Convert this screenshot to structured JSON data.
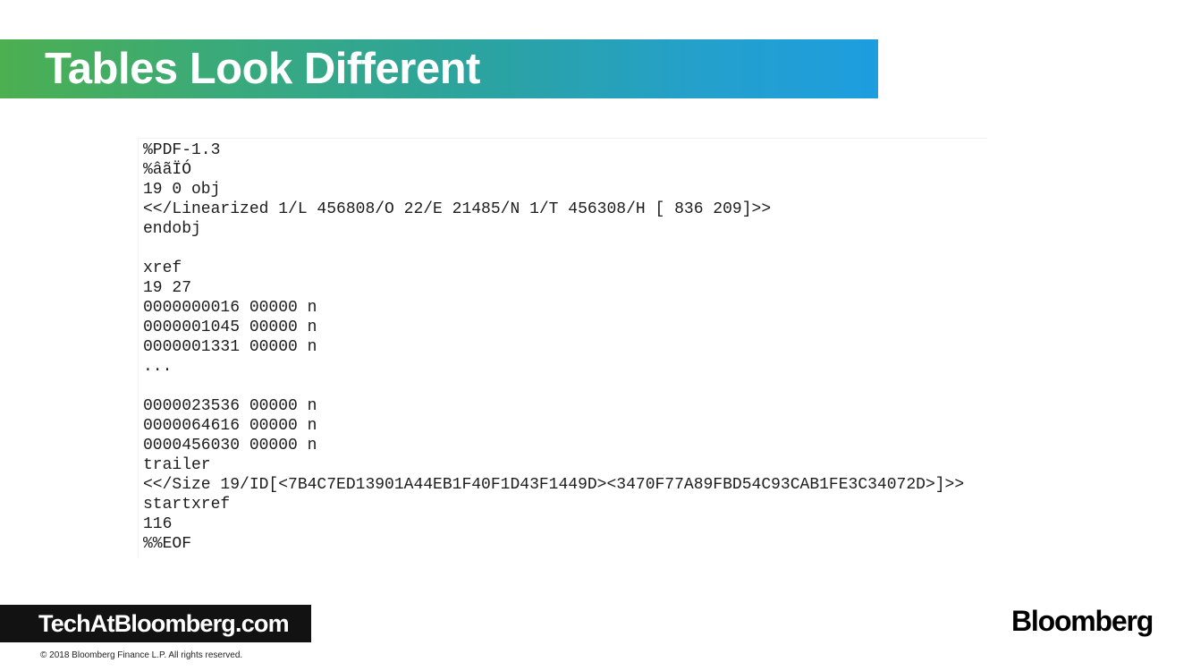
{
  "slide": {
    "title": "Tables Look Different"
  },
  "code": {
    "lines": [
      "%PDF-1.3",
      "%âãÏÓ",
      "19 0 obj",
      "<</Linearized 1/L 456808/O 22/E 21485/N 1/T 456308/H [ 836 209]>>",
      "endobj",
      "",
      "xref",
      "19 27",
      "0000000016 00000 n",
      "0000001045 00000 n",
      "0000001331 00000 n",
      "...",
      "",
      "0000023536 00000 n",
      "0000064616 00000 n",
      "0000456030 00000 n",
      "trailer",
      "<</Size 19/ID[<7B4C7ED13901A44EB1F40F1D43F1449D><3470F77A89FBD54C93CAB1FE3C34072D>]>>",
      "startxref",
      "116",
      "%%EOF"
    ]
  },
  "footer": {
    "site": "TechAtBloomberg.com",
    "copyright": "© 2018 Bloomberg  Finance L.P.  All rights reserved.",
    "brand": "Bloomberg"
  },
  "colors": {
    "banner_start": "#4caf50",
    "banner_end": "#1e9ddf",
    "footer_banner": "#121212"
  }
}
